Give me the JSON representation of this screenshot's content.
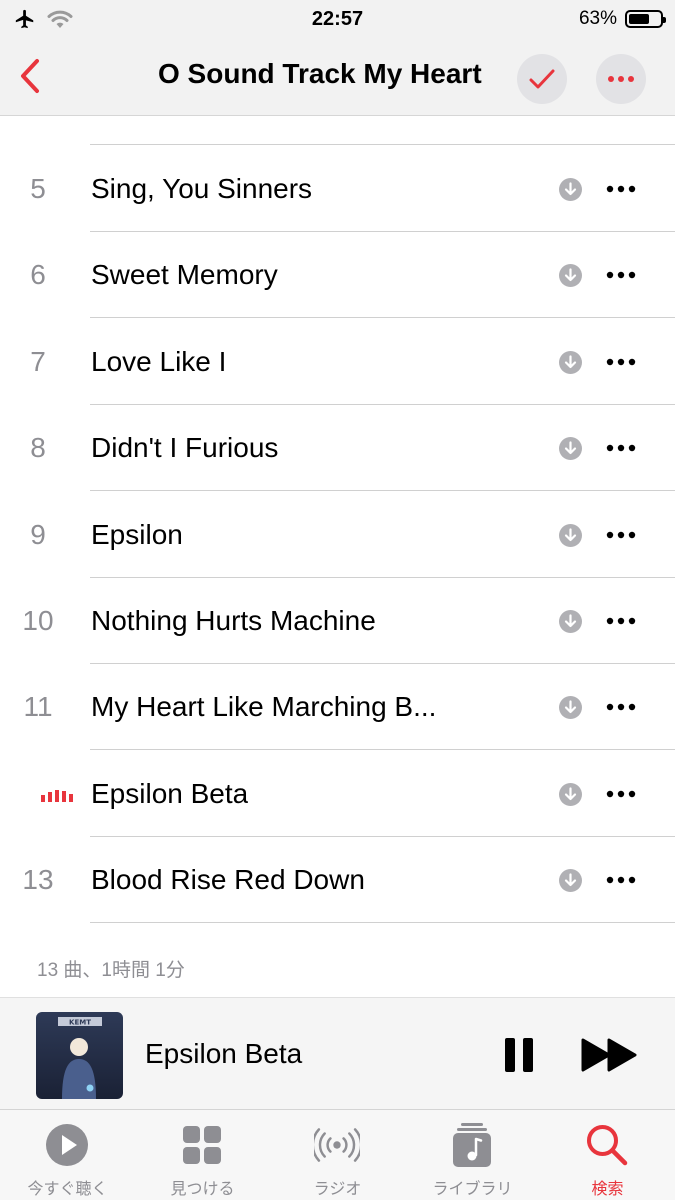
{
  "status": {
    "time": "22:57",
    "battery": "63%"
  },
  "nav": {
    "title": "O Sound Track My Heart"
  },
  "tracks": [
    {
      "number": "5",
      "title": "Sing, You Sinners",
      "playing": false
    },
    {
      "number": "6",
      "title": "Sweet Memory",
      "playing": false
    },
    {
      "number": "7",
      "title": "Love Like I",
      "playing": false
    },
    {
      "number": "8",
      "title": "Didn't I Furious",
      "playing": false
    },
    {
      "number": "9",
      "title": "Epsilon",
      "playing": false
    },
    {
      "number": "10",
      "title": "Nothing Hurts Machine",
      "playing": false
    },
    {
      "number": "11",
      "title": "My Heart Like Marching B...",
      "playing": false
    },
    {
      "number": "",
      "title": "Epsilon Beta",
      "playing": true
    },
    {
      "number": "13",
      "title": "Blood Rise Red Down",
      "playing": false
    }
  ],
  "summary": "13 曲、1時間 1分",
  "now_playing": {
    "title": "Epsilon Beta",
    "artwork_text": "KEMT"
  },
  "tabs": [
    {
      "label": "今すぐ聴く",
      "icon": "play-circle-icon",
      "active": false
    },
    {
      "label": "見つける",
      "icon": "grid-icon",
      "active": false
    },
    {
      "label": "ラジオ",
      "icon": "radio-icon",
      "active": false
    },
    {
      "label": "ライブラリ",
      "icon": "library-icon",
      "active": false
    },
    {
      "label": "検索",
      "icon": "search-icon",
      "active": true
    }
  ],
  "colors": {
    "accent": "#e8353d",
    "secondary_text": "#8e8e93",
    "icon_gray": "#b0b0b4"
  }
}
